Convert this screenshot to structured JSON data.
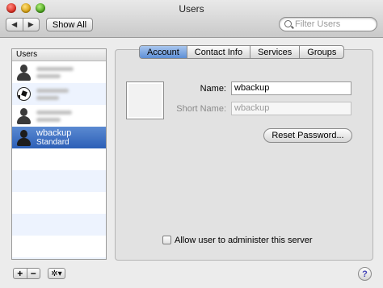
{
  "window": {
    "title": "Users"
  },
  "toolbar": {
    "back_icon": "◀",
    "forward_icon": "▶",
    "show_all_label": "Show All",
    "search_placeholder": "Filter Users",
    "search_value": ""
  },
  "sidebar": {
    "header": "Users",
    "users": [
      {
        "name": "",
        "subtitle": "",
        "avatar": "person-icon",
        "redacted": true
      },
      {
        "name": "",
        "subtitle": "",
        "avatar": "soccer-ball-icon",
        "redacted": true
      },
      {
        "name": "",
        "subtitle": "",
        "avatar": "person-icon",
        "redacted": true
      },
      {
        "name": "wbackup",
        "subtitle": "Standard",
        "avatar": "person-icon",
        "selected": true
      }
    ],
    "add_label": "+",
    "remove_label": "−",
    "action_label": "✲▾"
  },
  "tabs": [
    {
      "label": "Account",
      "active": true
    },
    {
      "label": "Contact Info"
    },
    {
      "label": "Services"
    },
    {
      "label": "Groups"
    }
  ],
  "account": {
    "name_label": "Name:",
    "name_value": "wbackup",
    "short_name_label": "Short Name:",
    "short_name_value": "wbackup",
    "reset_password_label": "Reset Password...",
    "admin_checkbox_label": "Allow user to administer this server",
    "admin_checked": false
  },
  "help_label": "?",
  "colors": {
    "selection": "#3d6ec4",
    "tab_active": "#7ea6e0"
  }
}
